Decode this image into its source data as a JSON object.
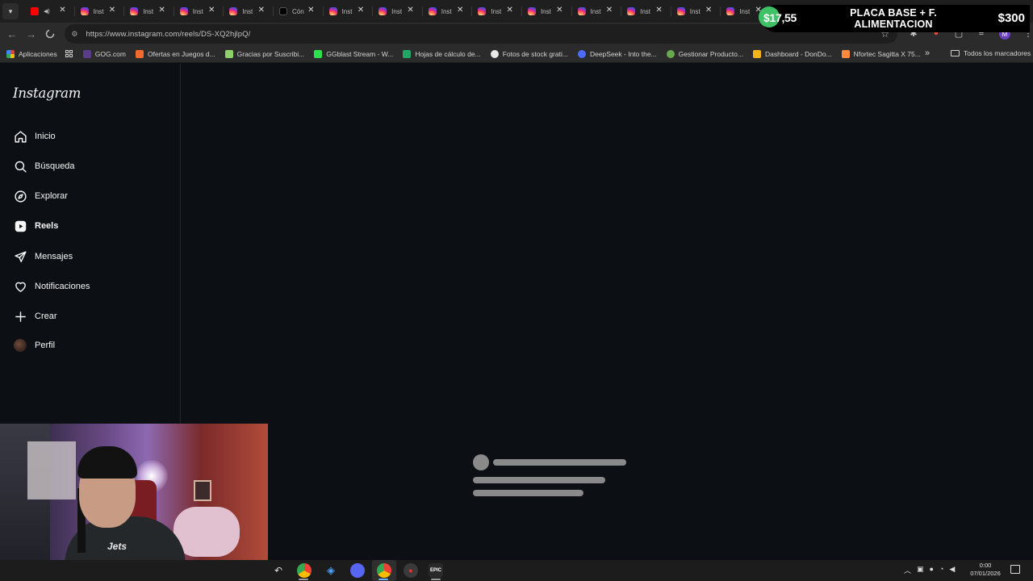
{
  "browser": {
    "tabs": [
      {
        "favicon": "youtube-icon",
        "title": "",
        "audio": true
      },
      {
        "favicon": "instagram-icon",
        "title": "Inst"
      },
      {
        "favicon": "instagram-icon",
        "title": "Inst"
      },
      {
        "favicon": "instagram-icon",
        "title": "Inst"
      },
      {
        "favicon": "instagram-icon",
        "title": "Inst"
      },
      {
        "favicon": "tiktok-icon",
        "title": "Cón"
      },
      {
        "favicon": "instagram-icon",
        "title": "Inst"
      },
      {
        "favicon": "instagram-icon",
        "title": "Inst"
      },
      {
        "favicon": "instagram-icon",
        "title": "Inst"
      },
      {
        "favicon": "instagram-icon",
        "title": "Inst"
      },
      {
        "favicon": "instagram-icon",
        "title": "Inst"
      },
      {
        "favicon": "instagram-icon",
        "title": "Inst"
      },
      {
        "favicon": "instagram-icon",
        "title": "Inst"
      },
      {
        "favicon": "instagram-icon",
        "title": "Inst"
      },
      {
        "favicon": "instagram-icon",
        "title": "Inst"
      },
      {
        "favicon": "instagram-icon",
        "title": "Inst"
      },
      {
        "favicon": "instagram-icon",
        "title": "Inst"
      }
    ],
    "url": "https://www.instagram.com/reels/DS-XQ2hjlpQ/",
    "profile_initial": "M",
    "bookmarks": [
      {
        "label": "Aplicaciones",
        "color": "#e94235"
      },
      {
        "label": "GOG.com",
        "color": "#ffffff"
      },
      {
        "label": "Ofertas en Juegos d...",
        "color": "#f26a2e"
      },
      {
        "label": "Gracias por Suscribi...",
        "color": "#8fd16a"
      },
      {
        "label": "GGblast Stream - W...",
        "color": "#2fe04a"
      },
      {
        "label": "Hojas de cálculo de...",
        "color": "#23a566"
      },
      {
        "label": "Fotos de stock grati...",
        "color": "#ffffff"
      },
      {
        "label": "DeepSeek - Into the...",
        "color": "#4d6bfe"
      },
      {
        "label": "Gestionar Producto...",
        "color": "#6aa84f"
      },
      {
        "label": "Dashboard - DonDo...",
        "color": "#f6b21b"
      },
      {
        "label": "Nfortec Sagitta X 75...",
        "color": "#ff8a3d"
      }
    ],
    "all_bookmarks_label": "Todos los marcadores"
  },
  "stream_overlay": {
    "raised": "$17,55",
    "goal_title": "PLACA BASE + F. ALIMENTACION",
    "goal_amount": "$300",
    "accent": "#3ec167"
  },
  "instagram": {
    "logo": "Instagram",
    "nav": [
      {
        "label": "Inicio",
        "icon": "home-icon"
      },
      {
        "label": "Búsqueda",
        "icon": "search-icon"
      },
      {
        "label": "Explorar",
        "icon": "compass-icon"
      },
      {
        "label": "Reels",
        "icon": "reels-icon",
        "active": true
      },
      {
        "label": "Mensajes",
        "icon": "messages-icon"
      },
      {
        "label": "Notificaciones",
        "icon": "heart-icon"
      },
      {
        "label": "Crear",
        "icon": "plus-icon"
      },
      {
        "label": "Perfil",
        "icon": "avatar"
      }
    ],
    "loading": true
  },
  "webcam": {
    "shirt_text": "Jets"
  },
  "taskbar": {
    "time": "0:00",
    "date": "07/01/2026"
  }
}
